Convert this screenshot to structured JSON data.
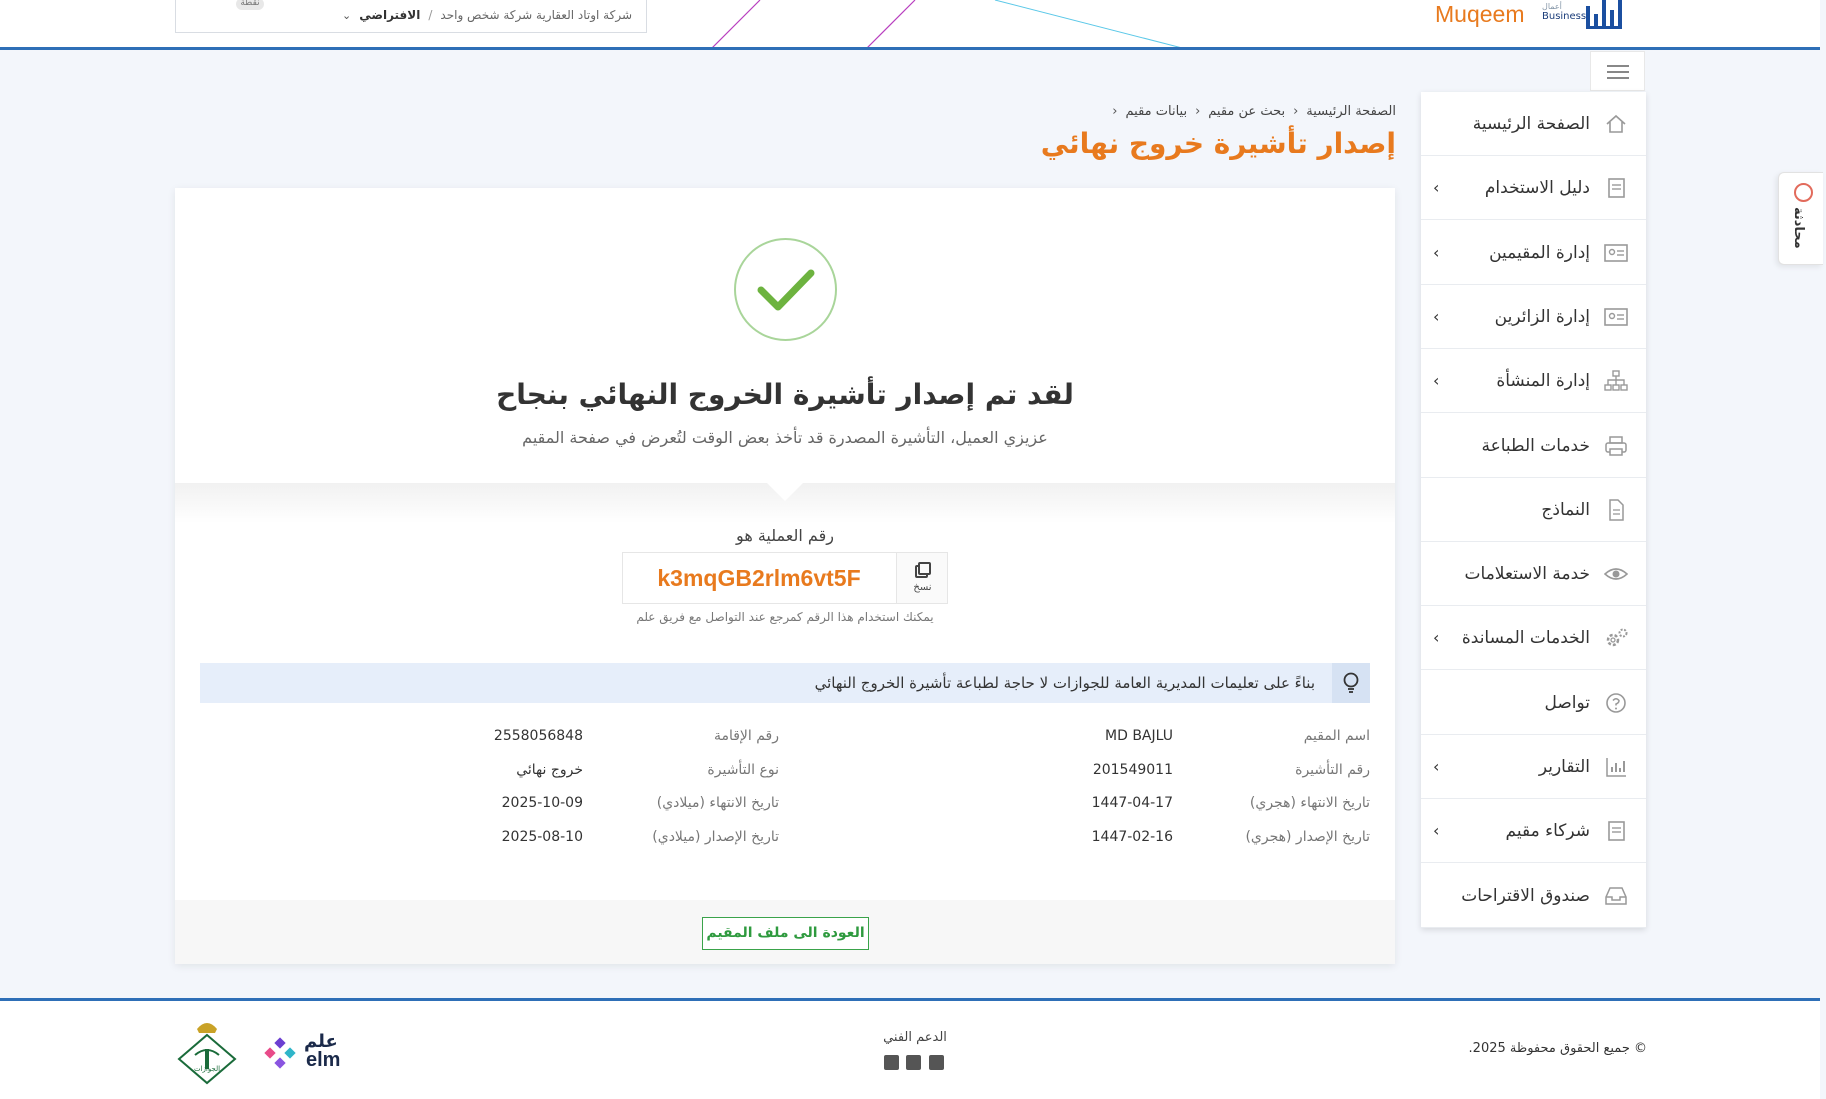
{
  "header": {
    "company_name": "شركة اوتاد العقارية شركة شخص واحد",
    "separator": "/",
    "default_label": "الافتراضي",
    "points_label": "نقطة",
    "brand_name": "Muqeem",
    "brand_sub_line1": "أعمال",
    "brand_sub_line2": "Business"
  },
  "chat_tab": {
    "label": "محادثة"
  },
  "sidebar": {
    "items": [
      {
        "label": "الصفحة الرئيسية",
        "icon": "home-icon",
        "has_submenu": false
      },
      {
        "label": "دليل الاستخدام",
        "icon": "book-icon",
        "has_submenu": true
      },
      {
        "label": "إدارة المقيمين",
        "icon": "id-card-icon",
        "has_submenu": true
      },
      {
        "label": "إدارة الزائرين",
        "icon": "id-card-icon",
        "has_submenu": true
      },
      {
        "label": "إدارة المنشأة",
        "icon": "org-chart-icon",
        "has_submenu": true
      },
      {
        "label": "خدمات الطباعة",
        "icon": "printer-icon",
        "has_submenu": false
      },
      {
        "label": "النماذج",
        "icon": "document-icon",
        "has_submenu": false
      },
      {
        "label": "خدمة الاستعلامات",
        "icon": "eye-icon",
        "has_submenu": false
      },
      {
        "label": "الخدمات المساندة",
        "icon": "gears-icon",
        "has_submenu": true
      },
      {
        "label": "تواصل",
        "icon": "help-circle-icon",
        "has_submenu": false
      },
      {
        "label": "التقارير",
        "icon": "bar-chart-icon",
        "has_submenu": true
      },
      {
        "label": "شركاء مقيم",
        "icon": "book-icon",
        "has_submenu": true
      },
      {
        "label": "صندوق الاقتراحات",
        "icon": "inbox-icon",
        "has_submenu": false
      }
    ]
  },
  "breadcrumb": {
    "items": [
      "الصفحة الرئيسية",
      "بحث عن مقيم",
      "بيانات مقيم"
    ],
    "separator": "›"
  },
  "page_title": "إصدار تأشيرة خروج نهائي",
  "success": {
    "title": "لقد تم إصدار تأشيرة الخروج النهائي بنجاح",
    "subtitle": "عزيزي العميل، التأشيرة المصدرة قد تأخذ بعض الوقت لتُعرض في صفحة المقيم"
  },
  "transaction": {
    "label": "رقم العملية هو",
    "code": "k3mqGB2rlm6vt5F",
    "copy_label": "نسخ",
    "hint": "يمكنك استخدام هذا الرقم كمرجع عند التواصل مع فريق علم"
  },
  "info_banner": {
    "text": "بناءً على تعليمات المديرية العامة للجوازات لا حاجة لطباعة تأشيرة الخروج النهائي"
  },
  "details": {
    "right": [
      {
        "label": "اسم المقيم",
        "value": "MD BAJLU"
      },
      {
        "label": "رقم التأشيرة",
        "value": "201549011"
      },
      {
        "label": "تاريخ الانتهاء (هجري)",
        "value": "1447-04-17"
      },
      {
        "label": "تاريخ الإصدار (هجري)",
        "value": "1447-02-16"
      }
    ],
    "left": [
      {
        "label": "رقم الإقامة",
        "value": "2558056848"
      },
      {
        "label": "نوع التأشيرة",
        "value": "خروج نهائي"
      },
      {
        "label": "تاريخ الانتهاء (ميلادي)",
        "value": "2025-10-09"
      },
      {
        "label": "تاريخ الإصدار (ميلادي)",
        "value": "2025-08-10"
      }
    ]
  },
  "back_button": {
    "label": "العودة الى ملف المقيم"
  },
  "footer": {
    "copyright": "© جميع الحقوق محفوظة 2025.",
    "support_title": "الدعم الفني",
    "support_icons": [
      "phone-icon",
      "email-icon",
      "twitter-icon"
    ],
    "elm_ar": "علم",
    "elm_en": "elm",
    "jawazat_label": "الجوازات"
  },
  "colors": {
    "accent_orange": "#e87a1e",
    "brand_blue": "#2e6fb7",
    "success_green": "#6db33f",
    "button_green": "#2e9a3e"
  }
}
